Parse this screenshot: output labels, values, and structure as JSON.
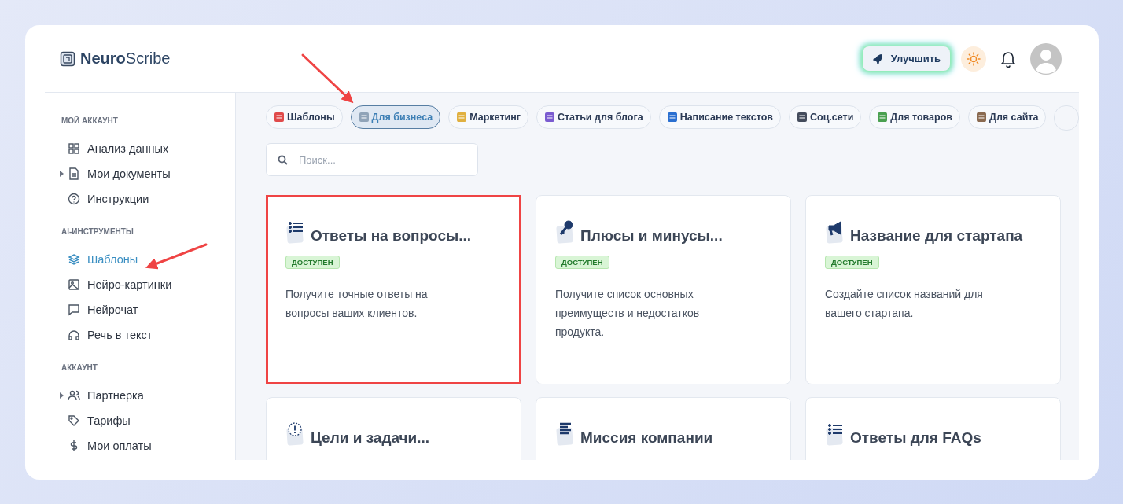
{
  "logo": {
    "bold": "Neuro",
    "rest": "Scribe"
  },
  "header": {
    "upgrade_button": "Улучшить"
  },
  "sidebar": {
    "sections": [
      {
        "title": "МОЙ АККАУНТ",
        "items": [
          {
            "label": "Анализ данных",
            "selected": false,
            "has_children": false
          },
          {
            "label": "Мои документы",
            "selected": false,
            "has_children": true
          },
          {
            "label": "Инструкции",
            "selected": false,
            "has_children": false
          }
        ]
      },
      {
        "title": "AI-ИНСТРУМЕНТЫ",
        "items": [
          {
            "label": "Шаблоны",
            "selected": true,
            "has_children": false
          },
          {
            "label": "Нейро-картинки",
            "selected": false,
            "has_children": false
          },
          {
            "label": "Нейрочат",
            "selected": false,
            "has_children": false
          },
          {
            "label": "Речь в текст",
            "selected": false,
            "has_children": false
          }
        ]
      },
      {
        "title": "АККАУНТ",
        "items": [
          {
            "label": "Партнерка",
            "selected": false,
            "has_children": true
          },
          {
            "label": "Тарифы",
            "selected": false,
            "has_children": false
          },
          {
            "label": "Мои оплаты",
            "selected": false,
            "has_children": false
          }
        ]
      }
    ]
  },
  "categories": [
    {
      "label": "Шаблоны",
      "selected": false
    },
    {
      "label": "Для бизнеса",
      "selected": true
    },
    {
      "label": "Маркетинг",
      "selected": false
    },
    {
      "label": "Статьи для блога",
      "selected": false
    },
    {
      "label": "Написание текстов",
      "selected": false
    },
    {
      "label": "Соц.сети",
      "selected": false
    },
    {
      "label": "Для товаров",
      "selected": false
    },
    {
      "label": "Для сайта",
      "selected": false
    }
  ],
  "search": {
    "placeholder": "Поиск..."
  },
  "cards": [
    {
      "title": "Ответы на вопросы...",
      "badge": "ДОСТУПЕН",
      "description": "Получите точные ответы на вопросы ваших клиентов.",
      "highlighted": true
    },
    {
      "title": "Плюсы и минусы...",
      "badge": "ДОСТУПЕН",
      "description": "Получите список основных преимуществ и недостатков продукта.",
      "highlighted": false
    },
    {
      "title": "Название для стартапа",
      "badge": "ДОСТУПЕН",
      "description": "Создайте список названий для вашего стартапа.",
      "highlighted": false
    },
    {
      "title": "Цели и задачи...",
      "highlighted": false
    },
    {
      "title": "Миссия компании",
      "highlighted": false
    },
    {
      "title": "Ответы для FAQs",
      "highlighted": false
    }
  ],
  "annotations": [
    {
      "kind": "arrow"
    },
    {
      "kind": "arrow"
    }
  ]
}
